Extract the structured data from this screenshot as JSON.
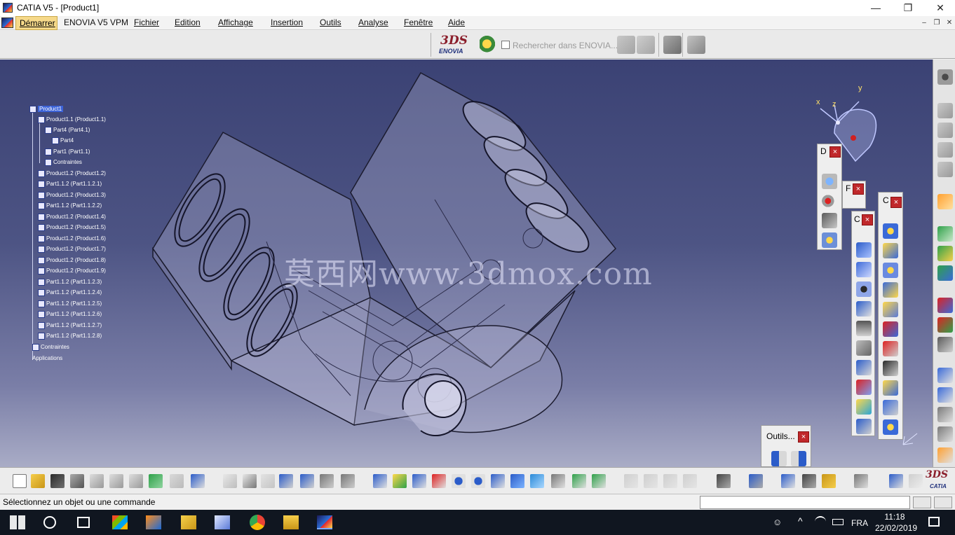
{
  "window": {
    "title": "CATIA V5 - [Product1]",
    "minimize": "—",
    "maximize": "❐",
    "close": "✕"
  },
  "menubar": {
    "start": "Démarrer",
    "items": [
      "ENOVIA V5 VPM",
      "Fichier",
      "Edition",
      "Affichage",
      "Insertion",
      "Outils",
      "Analyse",
      "Fenêtre",
      "Aide"
    ],
    "mdi_minimize": "–",
    "mdi_restore": "❐",
    "mdi_close": "✕"
  },
  "top_toolbar": {
    "logo_ds": "3DS",
    "logo_text": "ENOVIA",
    "search_label": "Rechercher dans ENOVIA...",
    "search_checked": false
  },
  "tree": {
    "root": "Product1",
    "items": [
      "Product1.1 (Product1.1)",
      "Part4 (Part4.1)",
      "Part4",
      "Part1 (Part1.1)",
      "Contraintes",
      "Product1.2 (Product1.2)",
      "Part1.1.2 (Part1.1.2.1)",
      "Product1.2 (Product1.3)",
      "Part1.1.2 (Part1.1.2.2)",
      "Product1.2 (Product1.4)",
      "Product1.2 (Product1.5)",
      "Product1.2 (Product1.6)",
      "Product1.2 (Product1.7)",
      "Product1.2 (Product1.8)",
      "Product1.2 (Product1.9)",
      "Part1.1.2 (Part1.1.2.3)",
      "Part1.1.2 (Part1.1.2.4)",
      "Part1.1.2 (Part1.1.2.5)",
      "Part1.1.2 (Part1.1.2.6)",
      "Part1.1.2 (Part1.1.2.7)",
      "Part1.1.2 (Part1.1.2.8)",
      "Contraintes",
      "Applications"
    ]
  },
  "watermark": "莫西网www.3dmox.com",
  "compass": {
    "x": "x",
    "y": "y",
    "z": "z"
  },
  "floating_toolbars": {
    "d_title": "D",
    "f_title": "F",
    "c1_title": "C",
    "c2_title": "C",
    "outils_title": "Outils...",
    "close": "×"
  },
  "statusbar": {
    "message": "Sélectionnez un objet ou une commande",
    "command_value": ""
  },
  "taskbar": {
    "lang": "FRA",
    "time": "11:18",
    "date": "22/02/2019"
  },
  "colors": {
    "viewport_top": "#3b4274",
    "viewport_bottom": "#a9acc6",
    "close_red": "#c0282b",
    "start_highlight": "#f6d98a"
  }
}
